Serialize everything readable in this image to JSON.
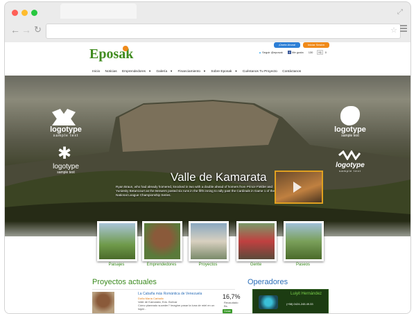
{
  "browser": {
    "colors": {
      "red": "#ff5f57",
      "yellow": "#febc2e",
      "green": "#28c840"
    }
  },
  "site": {
    "logo": "Eposak",
    "buttons": {
      "join": "¡Únete Ahora!",
      "login": "Iniciar Sesión"
    },
    "social": {
      "follow": "Seguir @eposak",
      "like": "Me gusta",
      "like_count": "130",
      "plus": "+1",
      "plus_count": "0"
    },
    "nav": [
      "Inicio",
      "Noticias",
      "Emprendedores",
      "Galería",
      "Financiamiento",
      "Sobre Eposak",
      "Cuéntanos Tu Proyecto",
      "Contáctanos"
    ]
  },
  "hero": {
    "title": "Valle de Kamarata",
    "text": "Ryan Braun, who had already homered, knocked in two with a double ahead of homers from Prince Fielder and Yuniesky Betancourt as the Brewers posted six runs in the fifth inning to rally past the Cardinals in Game 1 of the National League Championship Series.",
    "logos": [
      {
        "word": "logotype",
        "sub": "sample text"
      },
      {
        "word": "logotype",
        "sub": "sample text"
      },
      {
        "word": "logotype",
        "sub": "sample text"
      },
      {
        "word": "logotype",
        "sub": "sample text"
      }
    ]
  },
  "categories": [
    "Paisajes",
    "Emprendedores",
    "Proyectos",
    "Gente",
    "Paseos"
  ],
  "projects": {
    "heading": "Proyectos actuales",
    "item": {
      "title": "La Cabaña más Romántica de Venezuela",
      "author": "Doña María Carballo",
      "location": "Valle de Kamarata, Edo. Bolívar",
      "text": "Cómo planeado suceder? Imagine pasar la luna de miel en un lugar...",
      "percent": "16,7%",
      "raised_label": "Recaudado",
      "amount": "Bs.",
      "donate": "Donar"
    }
  },
  "operators": {
    "heading": "Operadores",
    "item": {
      "name": "Luiyit Hernández",
      "phone": "(+58) 0424-245.49.33"
    }
  }
}
